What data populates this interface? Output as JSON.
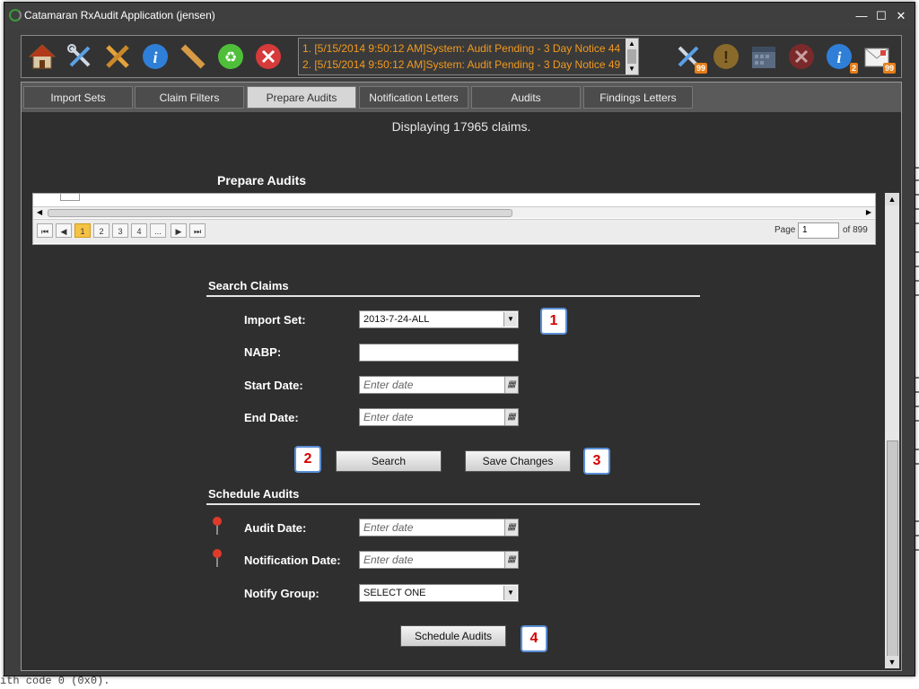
{
  "window": {
    "title": "Catamaran RxAudit Application (jensen)",
    "minimize": "—",
    "maximize": "☐",
    "close": "✕"
  },
  "toolbar": {
    "left_tools": [
      "home-icon",
      "tools-icon",
      "wrench-cross-icon",
      "info-icon",
      "ruler-icon",
      "recycle-icon",
      "close-red-icon"
    ],
    "messages": [
      "1. [5/15/2014 9:50:12 AM]System: Audit Pending - 3 Day Notice 44",
      "2. [5/15/2014 9:50:12 AM]System: Audit Pending - 3 Day Notice 49"
    ],
    "right_tools": [
      {
        "icon": "tools-icon",
        "badge": "99"
      },
      {
        "icon": "alert-icon",
        "badge": ""
      },
      {
        "icon": "calendar-icon",
        "badge": ""
      },
      {
        "icon": "close-red-icon",
        "badge": ""
      },
      {
        "icon": "info-icon",
        "badge": "2"
      },
      {
        "icon": "mail-icon",
        "badge": "99"
      }
    ]
  },
  "tabs": [
    "Import Sets",
    "Claim Filters",
    "Prepare Audits",
    "Notification Letters",
    "Audits",
    "Findings Letters"
  ],
  "active_tab": "Prepare Audits",
  "status": "Displaying 17965 claims.",
  "section_title": "Prepare Audits",
  "pager": {
    "pages": [
      "1",
      "2",
      "3",
      "4",
      "..."
    ],
    "page_label": "Page",
    "page_value": "1",
    "of_label": "of 899"
  },
  "search": {
    "heading": "Search Claims",
    "import_set_label": "Import Set:",
    "import_set_value": "2013-7-24-ALL",
    "nabp_label": "NABP:",
    "nabp_value": "",
    "start_date_label": "Start Date:",
    "start_date_placeholder": "Enter date",
    "end_date_label": "End Date:",
    "end_date_placeholder": "Enter date",
    "search_button": "Search",
    "save_button": "Save Changes"
  },
  "schedule": {
    "heading": "Schedule Audits",
    "audit_date_label": "Audit Date:",
    "audit_date_placeholder": "Enter date",
    "notification_date_label": "Notification Date:",
    "notification_date_placeholder": "Enter date",
    "notify_group_label": "Notify Group:",
    "notify_group_value": "SELECT ONE",
    "schedule_button": "Schedule Audits"
  },
  "callouts": [
    "1",
    "2",
    "3",
    "4"
  ],
  "background_text": "ith code 0 (0x0)."
}
